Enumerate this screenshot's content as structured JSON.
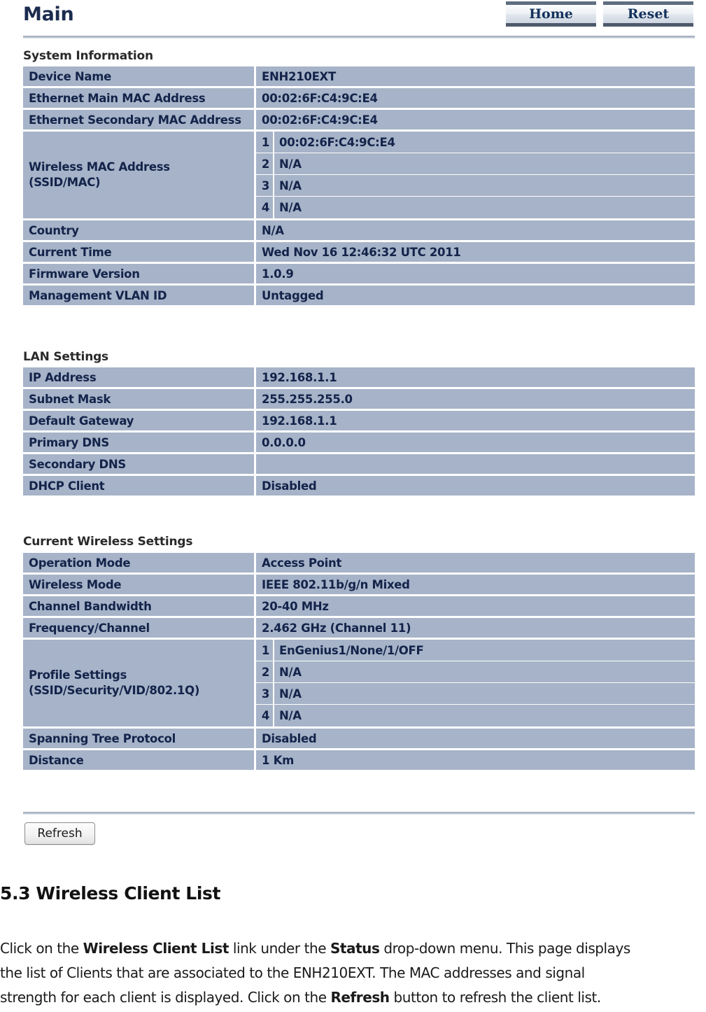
{
  "router_ui": {
    "page_title": "Main",
    "top_buttons": [
      {
        "label": "Home",
        "name": "home-button"
      },
      {
        "label": "Reset",
        "name": "reset-button"
      }
    ],
    "sections": [
      {
        "heading": "System Information",
        "rows": [
          {
            "label": "Device Name",
            "value": "ENH210EXT"
          },
          {
            "label": "Ethernet Main MAC Address",
            "value": "00:02:6F:C4:9C:E4"
          },
          {
            "label": "Ethernet Secondary MAC Address",
            "value": "00:02:6F:C4:9C:E4"
          },
          {
            "label": "Wireless MAC Address\n(SSID/MAC)",
            "label_line1": "Wireless MAC Address",
            "label_line2": "(SSID/MAC)",
            "sub_rows": [
              {
                "index": "1",
                "value": "00:02:6F:C4:9C:E4"
              },
              {
                "index": "2",
                "value": "N/A"
              },
              {
                "index": "3",
                "value": "N/A"
              },
              {
                "index": "4",
                "value": "N/A"
              }
            ]
          },
          {
            "label": "Country",
            "value": "N/A"
          },
          {
            "label": "Current Time",
            "value": "Wed Nov 16 12:46:32 UTC 2011"
          },
          {
            "label": "Firmware Version",
            "value": "1.0.9"
          },
          {
            "label": "Management VLAN ID",
            "value": "Untagged"
          }
        ]
      },
      {
        "heading": "LAN Settings",
        "rows": [
          {
            "label": "IP Address",
            "value": "192.168.1.1"
          },
          {
            "label": "Subnet Mask",
            "value": "255.255.255.0"
          },
          {
            "label": "Default Gateway",
            "value": "192.168.1.1"
          },
          {
            "label": "Primary DNS",
            "value": "0.0.0.0"
          },
          {
            "label": "Secondary DNS",
            "value": ""
          },
          {
            "label": "DHCP Client",
            "value": "Disabled"
          }
        ]
      },
      {
        "heading": "Current Wireless Settings",
        "rows": [
          {
            "label": "Operation Mode",
            "value": "Access Point"
          },
          {
            "label": "Wireless Mode",
            "value": "IEEE 802.11b/g/n Mixed"
          },
          {
            "label": "Channel Bandwidth",
            "value": "20-40 MHz"
          },
          {
            "label": "Frequency/Channel",
            "value": "2.462 GHz (Channel 11)"
          },
          {
            "label_line1": "Profile Settings",
            "label_line2": "(SSID/Security/VID/802.1Q)",
            "sub_rows": [
              {
                "index": "1",
                "value": "EnGenius1/None/1/OFF"
              },
              {
                "index": "2",
                "value": "N/A"
              },
              {
                "index": "3",
                "value": "N/A"
              },
              {
                "index": "4",
                "value": "N/A"
              }
            ]
          },
          {
            "label": "Spanning Tree Protocol",
            "value": "Disabled"
          },
          {
            "label": "Distance",
            "value": "1 Km"
          }
        ]
      }
    ],
    "refresh_label": "Refresh",
    "colors": {
      "cell_background": "#a6b3c8",
      "cell_text": "#14234a",
      "title_text": "#1b2c4f",
      "button_text": "#14325c",
      "rule": "#9aa5b4"
    }
  },
  "document": {
    "heading": "5.3 Wireless Client List",
    "paragraph": {
      "line1_a": "Click on the ",
      "line1_b": "Wireless Client List",
      "line1_c": " link under the ",
      "line1_d": "Status",
      "line1_e": " drop-down menu. This page displays",
      "line2": "the list of Clients that are associated to the ENH210EXT. The MAC addresses and signal",
      "line3_a": "strength for each client is displayed. Click on the ",
      "line3_b": "Refresh",
      "line3_c": " button to refresh the client list."
    }
  }
}
